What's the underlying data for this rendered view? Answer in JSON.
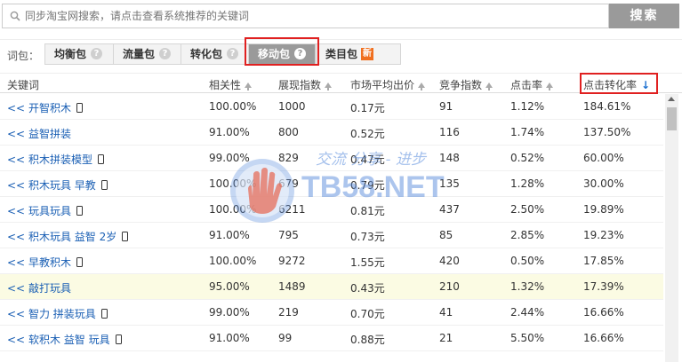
{
  "search": {
    "placeholder": "同步淘宝网搜索，请点击查看系统推荐的关键词",
    "button_label": "搜索"
  },
  "packages": {
    "label": "词包：",
    "tabs": [
      {
        "label": "均衡包",
        "badge": "?"
      },
      {
        "label": "流量包",
        "badge": "?"
      },
      {
        "label": "转化包",
        "badge": "?"
      },
      {
        "label": "移动包",
        "badge": "?",
        "active": true
      },
      {
        "label": "类目包",
        "badge": "新"
      }
    ]
  },
  "table": {
    "headers": [
      "关键词",
      "相关性",
      "展现指数",
      "市场平均出价",
      "竞争指数",
      "点击率",
      "点击转化率"
    ],
    "rows": [
      {
        "add": "<<",
        "keyword": "开智积木",
        "mobile": true,
        "relevance": "100.00%",
        "impressions": "1000",
        "avg_bid": "0.17元",
        "competition": "91",
        "ctr": "1.12%",
        "cvr": "184.61%"
      },
      {
        "add": "<<",
        "keyword": "益智拼装",
        "mobile": false,
        "relevance": "91.00%",
        "impressions": "800",
        "avg_bid": "0.52元",
        "competition": "116",
        "ctr": "1.74%",
        "cvr": "137.50%"
      },
      {
        "add": "<<",
        "keyword": "积木拼装模型",
        "mobile": true,
        "relevance": "99.00%",
        "impressions": "829",
        "avg_bid": "0.47元",
        "competition": "148",
        "ctr": "0.52%",
        "cvr": "60.00%"
      },
      {
        "add": "<<",
        "keyword": "积木玩具 早教",
        "mobile": true,
        "relevance": "100.00%",
        "impressions": "679",
        "avg_bid": "0.79元",
        "competition": "135",
        "ctr": "1.28%",
        "cvr": "30.00%"
      },
      {
        "add": "<<",
        "keyword": "玩具玩具",
        "mobile": true,
        "relevance": "100.00%",
        "impressions": "6211",
        "avg_bid": "0.81元",
        "competition": "437",
        "ctr": "2.50%",
        "cvr": "19.89%"
      },
      {
        "add": "<<",
        "keyword": "积木玩具 益智 2岁",
        "mobile": true,
        "relevance": "91.00%",
        "impressions": "795",
        "avg_bid": "0.73元",
        "competition": "85",
        "ctr": "2.85%",
        "cvr": "19.23%"
      },
      {
        "add": "<<",
        "keyword": "早教积木",
        "mobile": true,
        "relevance": "100.00%",
        "impressions": "9272",
        "avg_bid": "1.55元",
        "competition": "420",
        "ctr": "0.50%",
        "cvr": "17.85%"
      },
      {
        "add": "<<",
        "keyword": "敲打玩具",
        "mobile": false,
        "relevance": "95.00%",
        "impressions": "1489",
        "avg_bid": "0.43元",
        "competition": "210",
        "ctr": "1.32%",
        "cvr": "17.39%",
        "highlight": true
      },
      {
        "add": "<<",
        "keyword": "智力 拼装玩具",
        "mobile": true,
        "relevance": "99.00%",
        "impressions": "219",
        "avg_bid": "0.70元",
        "competition": "41",
        "ctr": "2.44%",
        "cvr": "16.66%"
      },
      {
        "add": "<<",
        "keyword": "软积木 益智 玩具",
        "mobile": true,
        "relevance": "91.00%",
        "impressions": "99",
        "avg_bid": "0.88元",
        "competition": "21",
        "ctr": "5.50%",
        "cvr": "16.66%"
      }
    ]
  },
  "watermark": {
    "slogan": "交流 分享 - 进步",
    "site": "TB58.NET"
  },
  "colors": {
    "highlight_border": "#e02020",
    "link_blue": "#1a5fb4",
    "sort_active": "#1a6fd0",
    "new_badge": "#f07020"
  },
  "icons": [
    "search-icon",
    "help-icon",
    "mobile-icon",
    "sort-arrow-icon"
  ]
}
